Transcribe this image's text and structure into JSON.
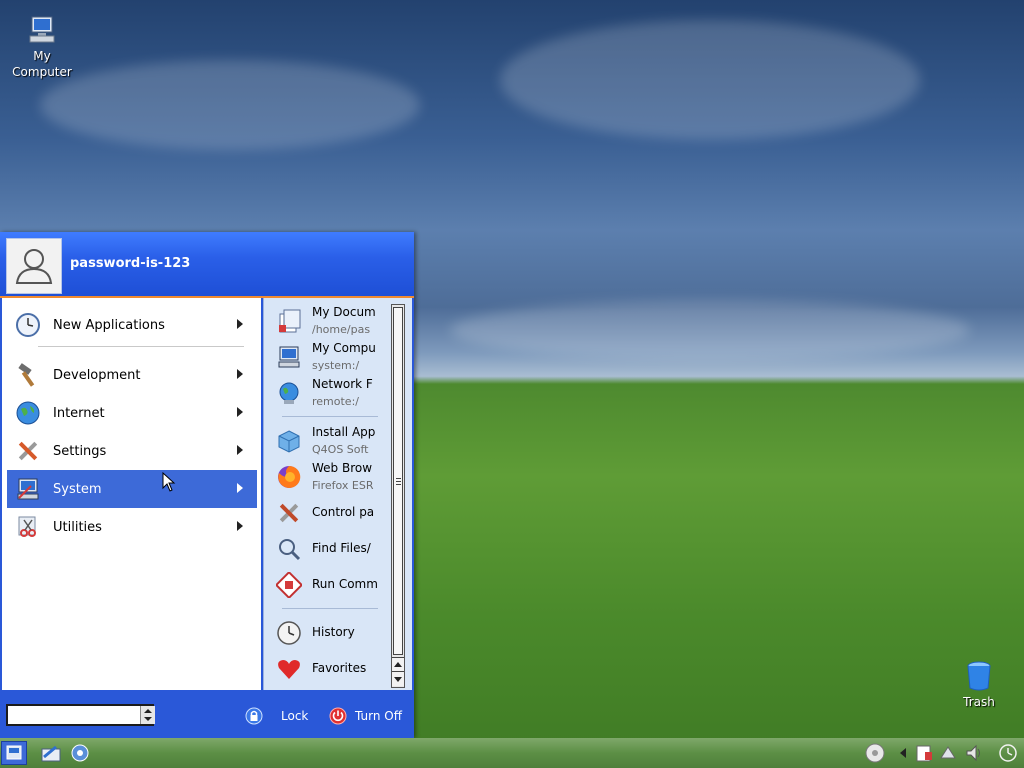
{
  "desktop": {
    "icons": [
      {
        "label_line1": "My",
        "label_line2": "Computer",
        "icon": "computer-icon"
      },
      {
        "label": "Trash",
        "icon": "trash-icon"
      }
    ]
  },
  "start_menu": {
    "user_name": "password-is-123",
    "categories": [
      {
        "label": "New Applications",
        "icon": "clock-icon",
        "selected": false
      },
      {
        "label": "Development",
        "icon": "hammer-icon",
        "selected": false
      },
      {
        "label": "Internet",
        "icon": "globe-icon",
        "selected": false
      },
      {
        "label": "Settings",
        "icon": "tools-icon",
        "selected": false
      },
      {
        "label": "System",
        "icon": "computer-icon",
        "selected": true
      },
      {
        "label": "Utilities",
        "icon": "scissors-icon",
        "selected": false
      }
    ],
    "right_items": [
      {
        "title": "My Docum",
        "subtitle": "/home/pas",
        "icon": "documents-icon"
      },
      {
        "title": "My Compu",
        "subtitle": "system:/",
        "icon": "computer-icon"
      },
      {
        "title": "Network F",
        "subtitle": "remote:/",
        "icon": "network-icon"
      },
      {
        "title": "Install App",
        "subtitle": "Q4OS Soft",
        "icon": "package-icon"
      },
      {
        "title": "Web Brow",
        "subtitle": "Firefox ESR",
        "icon": "firefox-icon"
      },
      {
        "title": "Control pa",
        "subtitle": "",
        "icon": "control-panel-icon"
      },
      {
        "title": "Find Files/",
        "subtitle": "",
        "icon": "find-icon"
      },
      {
        "title": "Run Comm",
        "subtitle": "",
        "icon": "run-icon"
      },
      {
        "title": "History",
        "subtitle": "",
        "icon": "history-icon"
      },
      {
        "title": "Favorites",
        "subtitle": "",
        "icon": "heart-icon"
      }
    ],
    "footer": {
      "search_value": "",
      "lock_label": "Lock",
      "turn_off_label": "Turn Off"
    }
  },
  "colors": {
    "menu_blue": "#2a58d8",
    "selection_blue": "#3d6ad8",
    "header_border": "#f08a30"
  }
}
